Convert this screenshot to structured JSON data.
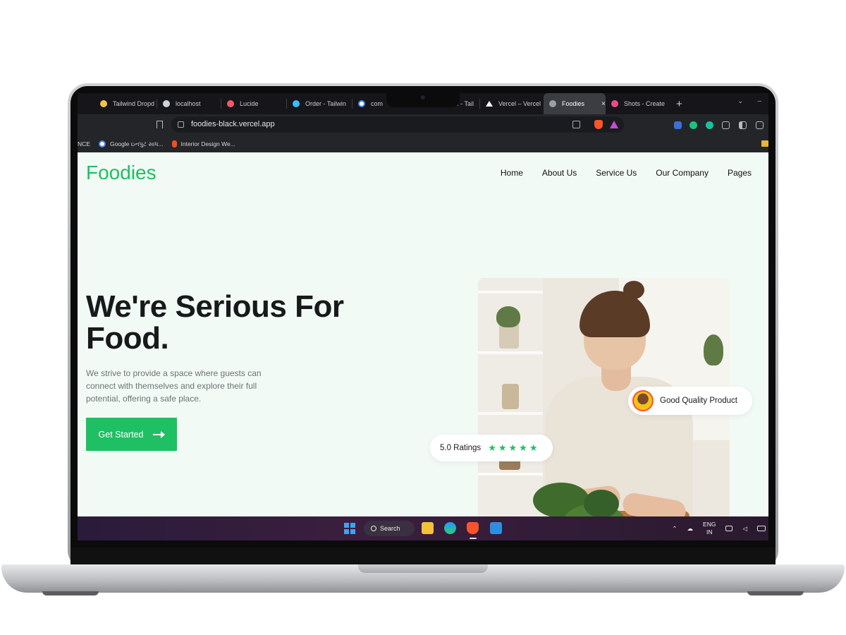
{
  "browser": {
    "tabs": [
      {
        "label": "Tailwind Dropd",
        "icon": "tailwind-dropdown-favicon",
        "color": "#f5c24a"
      },
      {
        "label": "localhost",
        "icon": "localhost-favicon",
        "color": "#cfd2d8"
      },
      {
        "label": "Lucide",
        "icon": "lucide-favicon",
        "color": "#f25b6a"
      },
      {
        "label": "Order - Tailwin",
        "icon": "tailwind-favicon",
        "color": "#38bdf8"
      },
      {
        "label": "com",
        "icon": "google-favicon",
        "color": "#ffffff"
      },
      {
        "label": "w - Tail",
        "icon": "tab-favicon",
        "color": "#9aa0a6"
      },
      {
        "label": "Vercel – Vercel",
        "icon": "vercel-favicon",
        "color": "#ffffff"
      },
      {
        "label": "Foodies",
        "icon": "globe-favicon",
        "color": "#9aa0a6",
        "active": true,
        "close": "×"
      },
      {
        "label": "Shots - Create",
        "icon": "shots-favicon",
        "color": "#ea4c89"
      }
    ],
    "new_tab": "+",
    "url": "foodies-black.vercel.app",
    "bookmarks": [
      {
        "label": "NCE",
        "icon": "bookmark-icon",
        "color": "#888888"
      },
      {
        "label": "Google ઇનપુટ સાધ...",
        "icon": "google-icon",
        "color": "#4285f4"
      },
      {
        "label": "Interior Design We...",
        "icon": "figma-icon",
        "color": "#f24e1e"
      }
    ]
  },
  "site": {
    "logo": "Foodies",
    "nav": [
      "Home",
      "About Us",
      "Service Us",
      "Our Company",
      "Pages"
    ],
    "hero_title": "We're Serious For Food.",
    "hero_subtitle": "We strive to provide a space where guests can connect with themselves and explore their full potential, offering a safe place.",
    "cta_label": "Get Started",
    "quality_badge": "Good Quality Product",
    "ratings_label": "5.0 Ratings",
    "rating_value": 5,
    "star_glyph": "★",
    "colors": {
      "brand": "#1fbf63",
      "background": "#f1faf4"
    }
  },
  "taskbar": {
    "search_label": "Search",
    "lang_primary": "ENG",
    "lang_secondary": "IN",
    "apps": [
      "windows-start",
      "file-explorer",
      "edge",
      "brave",
      "vscode"
    ]
  }
}
